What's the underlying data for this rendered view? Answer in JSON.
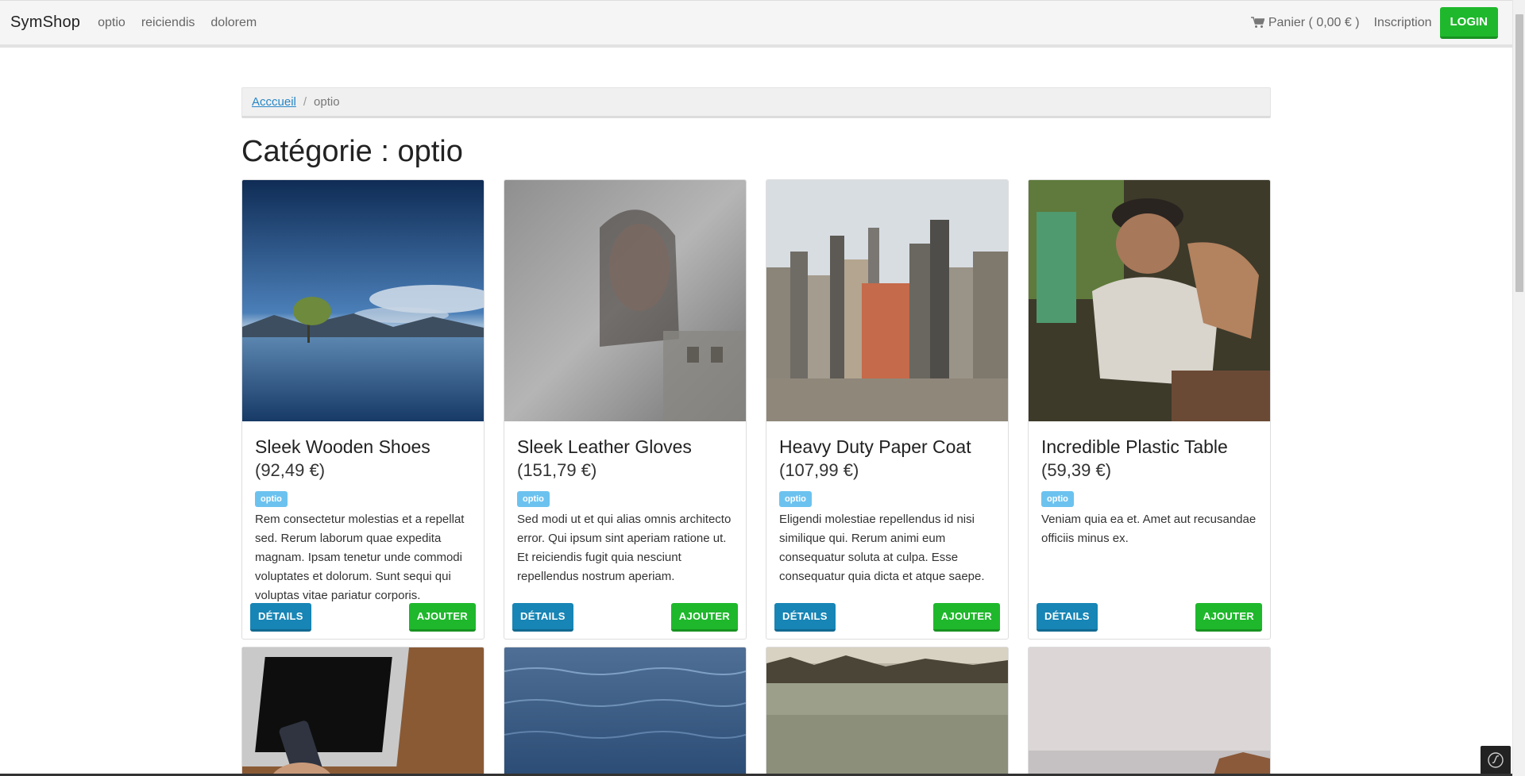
{
  "navbar": {
    "brand": "SymShop",
    "links": [
      "optio",
      "reiciendis",
      "dolorem"
    ],
    "cart_label": "Panier ( 0,00 € )",
    "signup_label": "Inscription",
    "login_label": "LOGIN"
  },
  "breadcrumb": {
    "home": "Acccueil",
    "current": "optio"
  },
  "page_title": "Catégorie : optio",
  "products": [
    {
      "title": "Sleek Wooden Shoes",
      "price": "(92,49 €)",
      "badge": "optio",
      "description": "Rem consectetur molestias et a repellat sed. Rerum laborum quae expedita magnam. Ipsam tenetur unde commodi voluptates et dolorum. Sunt sequi qui voluptas vitae pariatur corporis.",
      "details_label": "DÉTAILS",
      "add_label": "AJOUTER"
    },
    {
      "title": "Sleek Leather Gloves",
      "price": "(151,79 €)",
      "badge": "optio",
      "description": "Sed modi ut et qui alias omnis architecto error. Qui ipsum sint aperiam ratione ut. Et reiciendis fugit quia nesciunt repellendus nostrum aperiam.",
      "details_label": "DÉTAILS",
      "add_label": "AJOUTER"
    },
    {
      "title": "Heavy Duty Paper Coat",
      "price": "(107,99 €)",
      "badge": "optio",
      "description": "Eligendi molestiae repellendus id nisi similique qui. Rerum animi eum consequatur soluta at culpa. Esse consequatur quia dicta et atque saepe.",
      "details_label": "DÉTAILS",
      "add_label": "AJOUTER"
    },
    {
      "title": "Incredible Plastic Table",
      "price": "(59,39 €)",
      "badge": "optio",
      "description": "Veniam quia ea et. Amet aut recusandae officiis minus ex.",
      "details_label": "DÉTAILS",
      "add_label": "AJOUTER"
    }
  ],
  "colors": {
    "success": "#1fb82c",
    "primary": "#1785b5",
    "badge": "#6cc2ef"
  }
}
